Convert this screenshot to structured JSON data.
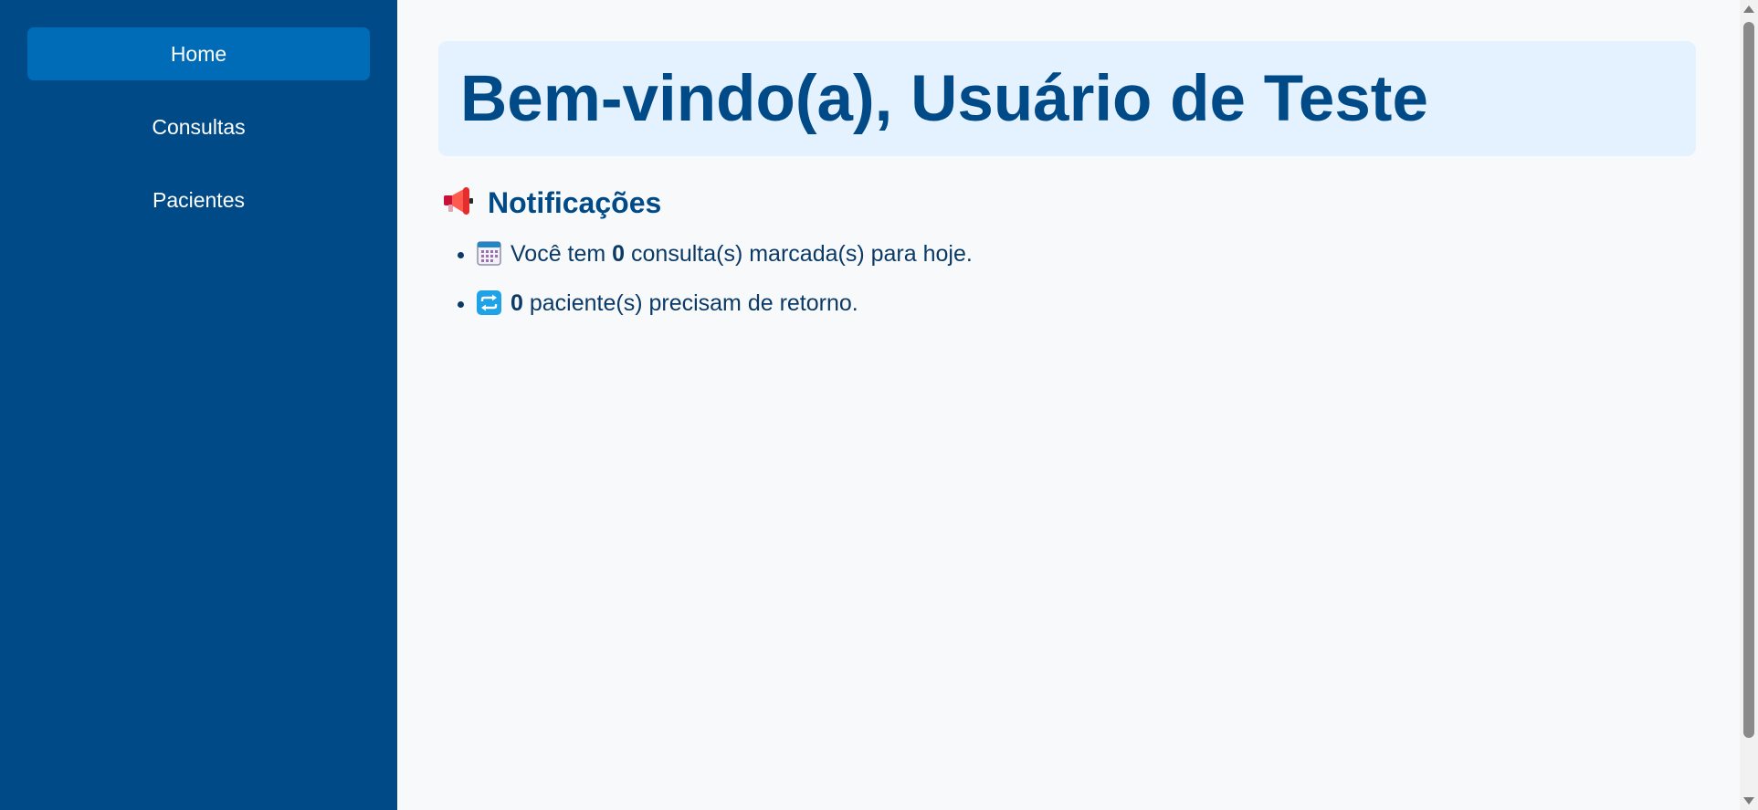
{
  "sidebar": {
    "items": [
      {
        "label": "Home",
        "active": true
      },
      {
        "label": "Consultas",
        "active": false
      },
      {
        "label": "Pacientes",
        "active": false
      }
    ]
  },
  "main": {
    "welcome_title": "Bem-vindo(a), Usuário de Teste",
    "notifications": {
      "icon": "megaphone-icon",
      "title": "Notificações",
      "items": [
        {
          "icon": "calendar-icon",
          "prefix": "Você tem ",
          "count": "0",
          "suffix": " consulta(s) marcada(s) para hoje."
        },
        {
          "icon": "repeat-icon",
          "prefix": "",
          "count": "0",
          "suffix": " paciente(s) precisam de retorno."
        }
      ]
    }
  },
  "colors": {
    "sidebar_bg": "#004a87",
    "active_item_bg": "#006cb7",
    "welcome_bg": "#e4f1ff",
    "heading_text": "#004a87"
  }
}
